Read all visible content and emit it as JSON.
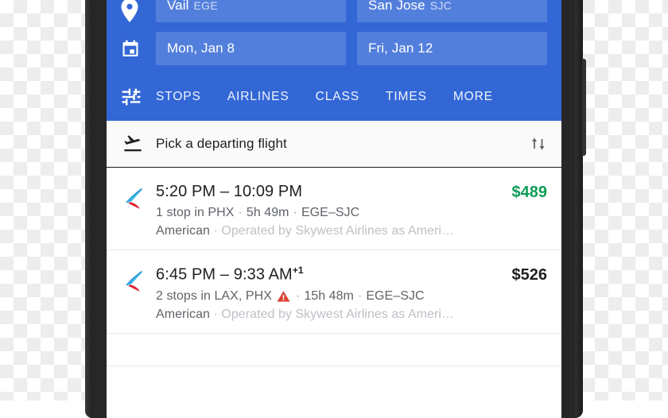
{
  "app": {
    "accent_blue": "#3367D6",
    "price_green": "#0f9d58",
    "warning_red": "#DB4437"
  },
  "header": {
    "origin_icon": "location-pin-icon",
    "date_icon": "calendar-icon",
    "filter_icon": "tune-sliders-icon",
    "origin": {
      "city": "Vail",
      "code": "EGE"
    },
    "destination": {
      "city": "San Jose",
      "code": "SJC"
    },
    "depart_date": "Mon, Jan 8",
    "return_date": "Fri, Jan 12",
    "filters": [
      "STOPS",
      "AIRLINES",
      "CLASS",
      "TIMES",
      "MORE"
    ]
  },
  "pick_bar": {
    "icon": "flight-takeoff-icon",
    "title": "Pick a departing flight",
    "sort_icon": "sort-arrows-icon"
  },
  "flights": [
    {
      "airline_logo": "american-airlines-logo",
      "times": "5:20 PM – 10:09 PM",
      "day_offset": "",
      "stops": "1 stop in PHX",
      "has_warning": false,
      "duration": "5h 49m",
      "route": "EGE–SJC",
      "carrier": "American",
      "operator": "Operated by Skywest Airlines as Ameri…",
      "price": "$489",
      "price_style": "green"
    },
    {
      "airline_logo": "american-airlines-logo",
      "times": "6:45 PM – 9:33 AM",
      "day_offset": "+1",
      "stops": "2 stops in LAX, PHX",
      "has_warning": true,
      "duration": "15h 48m",
      "route": "EGE–SJC",
      "carrier": "American",
      "operator": "Operated by Skywest Airlines as Ameri…",
      "price": "$526",
      "price_style": "dark"
    }
  ]
}
